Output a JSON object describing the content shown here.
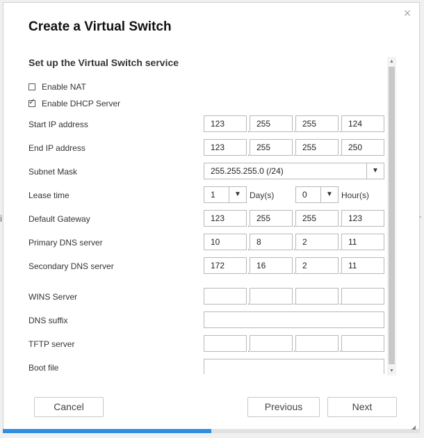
{
  "dialog": {
    "title": "Create a Virtual Switch",
    "close_icon": "close-icon"
  },
  "background": {
    "left_fragment": "i",
    "right_fragment": "r"
  },
  "section_title": "Set up the Virtual Switch service",
  "options": {
    "enable_nat": {
      "label": "Enable NAT",
      "checked": false
    },
    "enable_dhcp": {
      "label": "Enable DHCP Server",
      "checked": true,
      "check_glyph": "✓"
    }
  },
  "fields": {
    "start_ip": {
      "label": "Start IP address",
      "octets": [
        "123",
        "255",
        "255",
        "124"
      ]
    },
    "end_ip": {
      "label": "End IP address",
      "octets": [
        "123",
        "255",
        "255",
        "250"
      ]
    },
    "subnet_mask": {
      "label": "Subnet Mask",
      "value": "255.255.255.0 (/24)"
    },
    "lease_time": {
      "label": "Lease time",
      "days": "1",
      "days_unit": "Day(s)",
      "hours": "0",
      "hours_unit": "Hour(s)"
    },
    "default_gateway": {
      "label": "Default Gateway",
      "octets": [
        "123",
        "255",
        "255",
        "123"
      ]
    },
    "primary_dns": {
      "label": "Primary DNS server",
      "octets": [
        "10",
        "8",
        "2",
        "11"
      ]
    },
    "secondary_dns": {
      "label": "Secondary DNS server",
      "octets": [
        "172",
        "16",
        "2",
        "11"
      ]
    },
    "wins_server": {
      "label": "WINS Server",
      "octets": [
        "",
        "",
        "",
        ""
      ]
    },
    "dns_suffix": {
      "label": "DNS suffix",
      "value": ""
    },
    "tftp_server": {
      "label": "TFTP server",
      "octets": [
        "",
        "",
        "",
        ""
      ]
    },
    "boot_file": {
      "label": "Boot file",
      "value": ""
    }
  },
  "dropdown_icon": "▼",
  "buttons": {
    "cancel": "Cancel",
    "previous": "Previous",
    "next": "Next"
  },
  "progress": {
    "fraction": 0.5,
    "color": "#2f8ee0"
  },
  "colors": {
    "accent": "#2f8ee0",
    "border": "#b8b8b8"
  }
}
